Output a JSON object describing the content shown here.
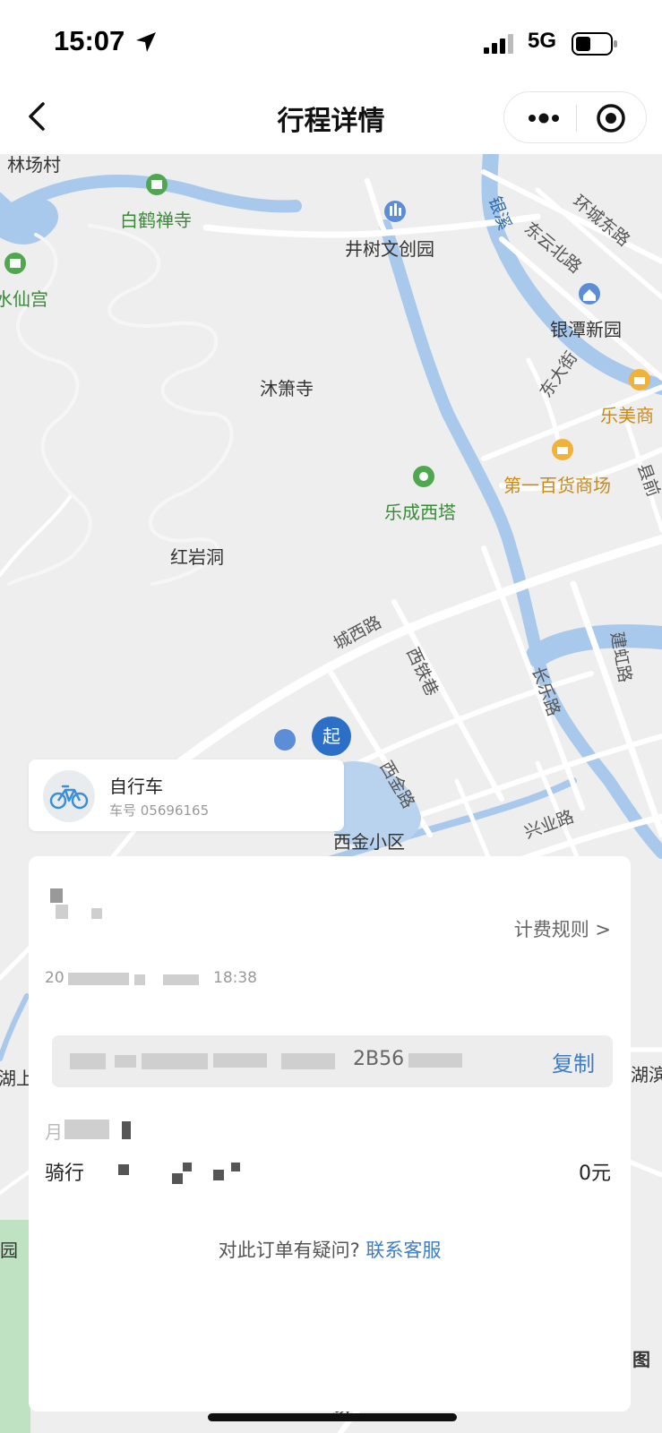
{
  "status_bar": {
    "time": "15:07",
    "network": "5G"
  },
  "nav": {
    "title": "行程详情"
  },
  "map": {
    "labels": {
      "linchang": "林场村",
      "baihe": "白鹤禅寺",
      "xianggong": "水仙宫",
      "jingshu": "井树文创园",
      "yinxi": "银溪",
      "dongyun": "东云北路",
      "huancheng": "环城东路",
      "yintan": "银潭新园",
      "dongda": "东大街",
      "lemei": "乐美商",
      "muxiao": "沐箫寺",
      "diyi": "第一百货商场",
      "county": "县前",
      "lecheng": "乐成西塔",
      "hongyan": "红岩洞",
      "chengxi": "城西路",
      "xitie": "西铁巷",
      "jianhong": "建虹路",
      "changle": "长乐路",
      "xijin": "西金路",
      "xingye": "兴业路",
      "start": "起",
      "xijin_area": "西金小区",
      "hu_left": "湖上",
      "hu_right": "湖滨",
      "yuan_left": "园",
      "tu": "图",
      "cheng": "城"
    }
  },
  "bike": {
    "name": "自行车",
    "plate": "车号 05696165"
  },
  "detail": {
    "fare_rule": "计费规则 >",
    "time_a": "20",
    "time_b": "18:38",
    "order_fragment": "2B56",
    "copy": "复制",
    "label_a": "月",
    "label_b": "骑行",
    "fee": "0元",
    "question": "对此订单有疑问?",
    "contact": "联系客服"
  },
  "colors": {
    "link": "#3d7cc9",
    "map_bg": "#eeeeee",
    "water": "#a8c8ec",
    "marker": "#2b6fc6"
  }
}
